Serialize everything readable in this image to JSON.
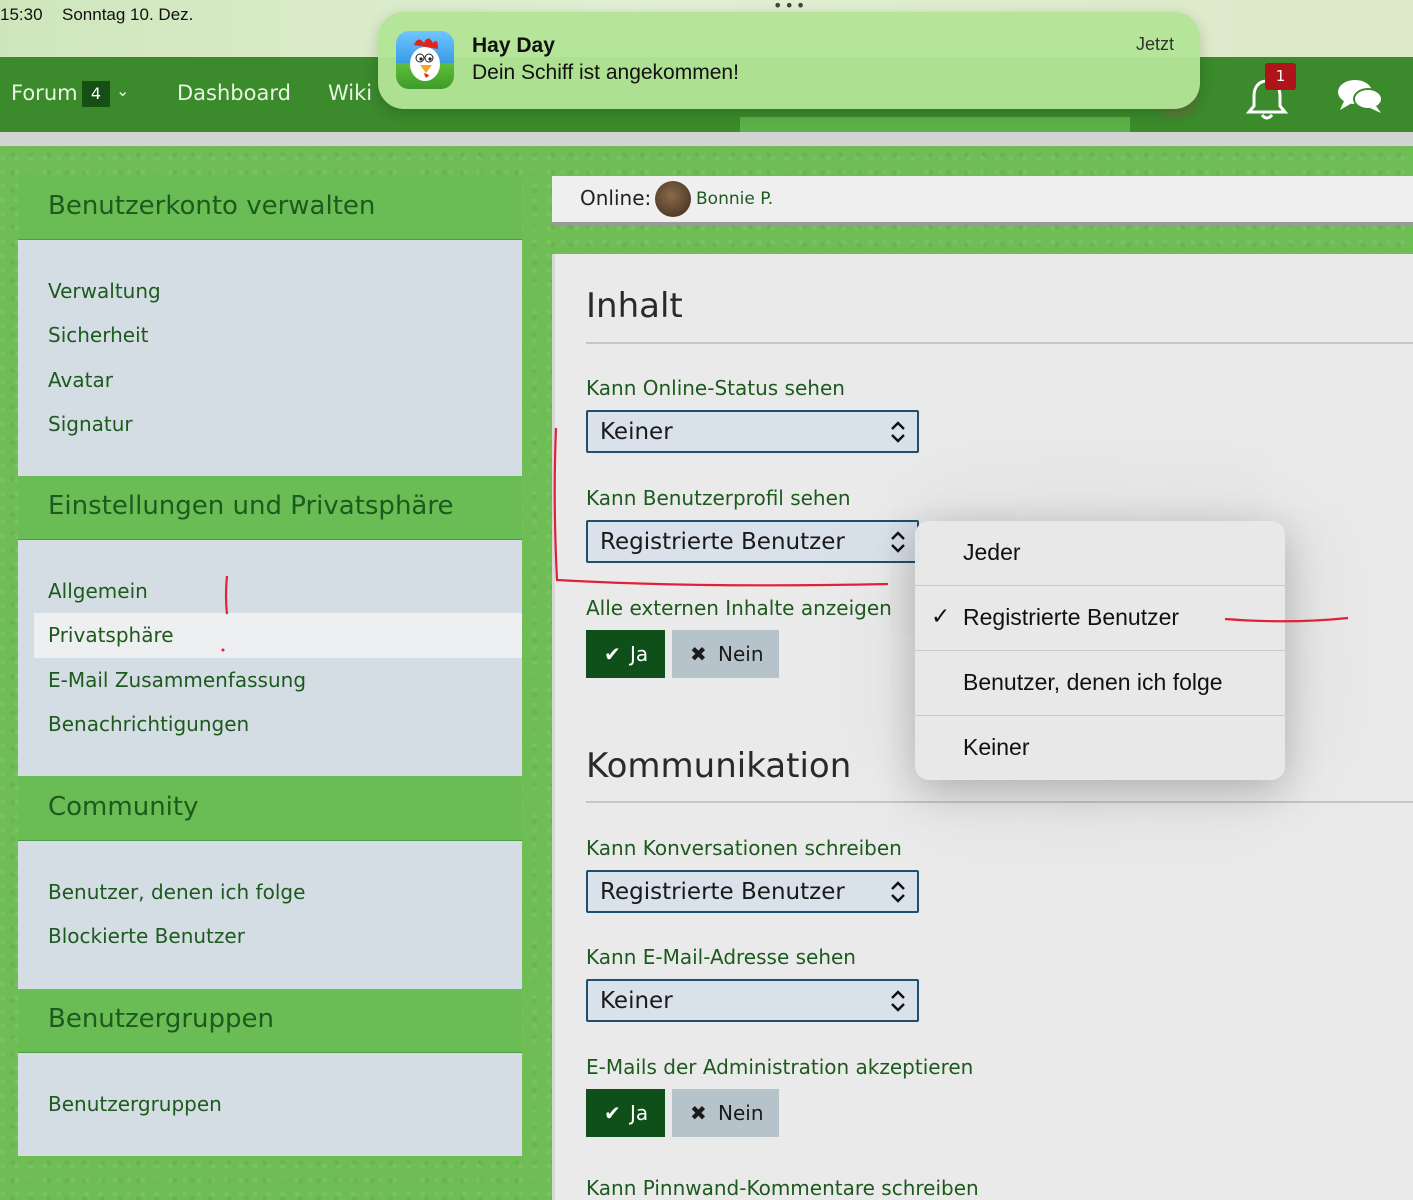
{
  "status_bar": {
    "time": "15:30",
    "date": "Sonntag 10. Dez."
  },
  "notification": {
    "app": "Hay Day",
    "message": "Dein Schiff ist angekommen!",
    "time": "Jetzt"
  },
  "nav": {
    "forum_label": "Forum",
    "forum_count": "4",
    "dashboard_label": "Dashboard",
    "wiki_label": "Wiki",
    "notifications_count": "1"
  },
  "sidebar": {
    "account": {
      "title": "Benutzerkonto verwalten",
      "items": [
        "Verwaltung",
        "Sicherheit",
        "Avatar",
        "Signatur"
      ]
    },
    "settings": {
      "title": "Einstellungen und Privatsphäre",
      "items": [
        "Allgemein",
        "Privatsphäre",
        "E-Mail Zusammenfassung",
        "Benachrichtigungen"
      ],
      "active": "Privatsphäre"
    },
    "community": {
      "title": "Community",
      "items": [
        "Benutzer, denen ich folge",
        "Blockierte Benutzer"
      ]
    },
    "groups": {
      "title": "Benutzergruppen",
      "items": [
        "Benutzergruppen"
      ]
    }
  },
  "online": {
    "label": "Online:",
    "user": "Bonnie P."
  },
  "content": {
    "section1": "Inhalt",
    "online_status": {
      "label": "Kann Online-Status sehen",
      "value": "Keiner"
    },
    "profile": {
      "label": "Kann Benutzerprofil sehen",
      "value": "Registrierte Benutzer"
    },
    "external": {
      "label": "Alle externen Inhalte anzeigen",
      "yes": "Ja",
      "no": "Nein"
    },
    "section2": "Kommunikation",
    "conversations": {
      "label": "Kann Konversationen schreiben",
      "value": "Registrierte Benutzer"
    },
    "email_addr": {
      "label": "Kann E-Mail-Adresse sehen",
      "value": "Keiner"
    },
    "admin_mail": {
      "label": "E-Mails der Administration akzeptieren",
      "yes": "Ja",
      "no": "Nein"
    },
    "wall": {
      "label": "Kann Pinnwand-Kommentare schreiben"
    }
  },
  "dropdown": {
    "options": [
      "Jeder",
      "Registrierte Benutzer",
      "Benutzer, denen ich folge",
      "Keiner"
    ],
    "selected": "Registrierte Benutzer"
  },
  "colors": {
    "nav_green": "#3b8a2c",
    "header_green": "#6abd54",
    "text_green": "#1d5a1d",
    "button_dark_green": "#0f4f1a",
    "badge_red": "#b0141b",
    "annotation_red": "#e0213a"
  }
}
